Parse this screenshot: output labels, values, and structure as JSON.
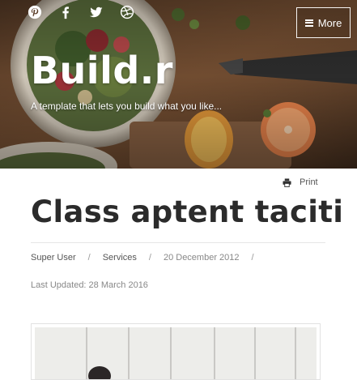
{
  "header": {
    "social_icons": [
      "pinterest-icon",
      "facebook-icon",
      "twitter-icon",
      "dribbble-icon"
    ],
    "more_label": "More",
    "site_title": "Build.r",
    "tagline": "A template that lets you build what you like..."
  },
  "article": {
    "print_label": "Print",
    "title": "Class aptent taciti",
    "author": "Super User",
    "category": "Services",
    "published": "20 December 2012",
    "separator": "/",
    "last_updated": "Last Updated: 28 March 2016"
  },
  "colors": {
    "text_dark": "#2b2b2b",
    "text_muted": "#888888",
    "divider": "#e6e6e6"
  }
}
